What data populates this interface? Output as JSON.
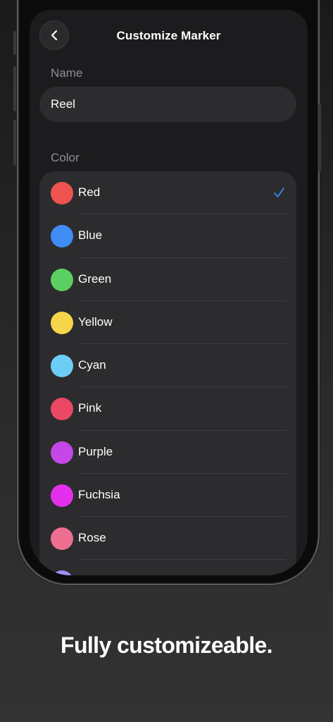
{
  "header": {
    "title": "Customize Marker",
    "back_icon": "chevron-left-icon"
  },
  "name_section": {
    "label": "Name",
    "value": "Reel"
  },
  "color_section": {
    "label": "Color",
    "selected": "Red",
    "check_color": "#3a82f7",
    "items": [
      {
        "label": "Red",
        "color": "#ef5350",
        "selected": true
      },
      {
        "label": "Blue",
        "color": "#3f8cf5",
        "selected": false
      },
      {
        "label": "Green",
        "color": "#5ccf63",
        "selected": false
      },
      {
        "label": "Yellow",
        "color": "#f7d54a",
        "selected": false
      },
      {
        "label": "Cyan",
        "color": "#6ccdf6",
        "selected": false
      },
      {
        "label": "Pink",
        "color": "#ec4863",
        "selected": false
      },
      {
        "label": "Purple",
        "color": "#c547e7",
        "selected": false
      },
      {
        "label": "Fuchsia",
        "color": "#e430ec",
        "selected": false
      },
      {
        "label": "Rose",
        "color": "#ef6f93",
        "selected": false
      },
      {
        "label": "",
        "color": "#a78bfa",
        "selected": false
      }
    ]
  },
  "caption": {
    "text": "Fully customizeable."
  }
}
